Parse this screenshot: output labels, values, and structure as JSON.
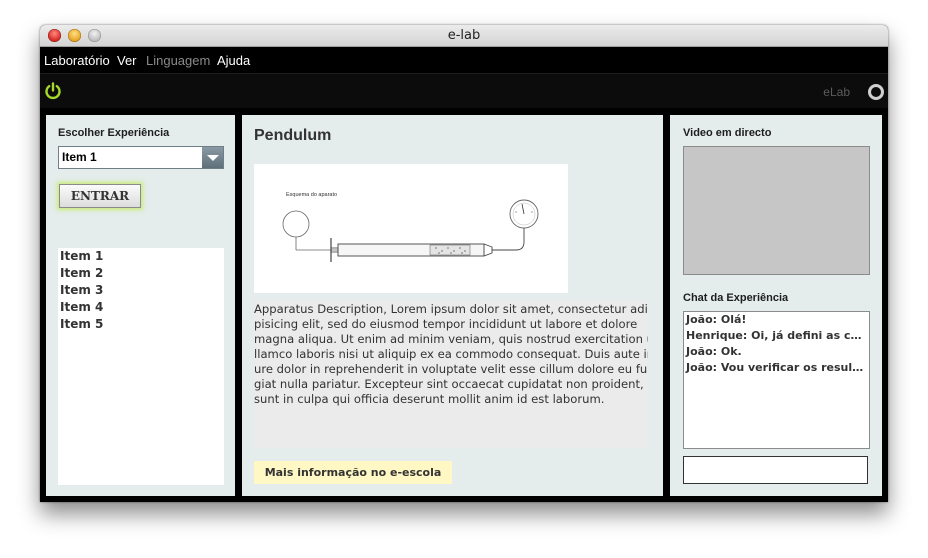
{
  "window": {
    "title": "e-lab"
  },
  "menu": {
    "items": [
      "Laboratório",
      "Ver",
      "Linguagem",
      "Ajuda"
    ]
  },
  "toolbar": {
    "brand": "eLab"
  },
  "left": {
    "choose_label": "Escolher Experiência",
    "combo_value": "Item 1",
    "enter_button": "ENTRAR",
    "items": [
      "Item 1",
      "Item 2",
      "Item 3",
      "Item 4",
      "Item 5"
    ]
  },
  "center": {
    "title": "Pendulum",
    "diagram_caption": "Esquema do aparato",
    "description_lines": [
      "Apparatus Description, Lorem ipsum dolor sit amet, consectetur adi",
      "pisicing elit, sed do eiusmod tempor incididunt ut labore et dolore",
      "magna aliqua. Ut enim ad minim veniam, quis nostrud exercitation u",
      "llamco laboris nisi ut aliquip ex ea commodo consequat. Duis aute ir",
      "ure dolor in reprehenderit in voluptate velit esse cillum dolore eu fu",
      "giat nulla pariatur. Excepteur sint occaecat cupidatat non proident,",
      "sunt in culpa qui officia deserunt mollit anim id est laborum."
    ],
    "more_link": "Mais informação no e-escola"
  },
  "right": {
    "video_label": "Video em directo",
    "chat_label": "Chat da Experiência",
    "chat_messages": [
      "João: Olá!",
      "Henrique: Oi, já defini as configurações",
      "João: Ok.",
      "João: Vou verificar os resultados"
    ],
    "chat_input_value": ""
  },
  "colors": {
    "panel_bg": "#e4ecec",
    "power_icon": "#a6d92a",
    "link_bg": "#fff7c4",
    "button_glow": "#c8ec7a"
  },
  "icons": [
    "power-icon",
    "status-ring-icon",
    "chevron-down-icon"
  ]
}
